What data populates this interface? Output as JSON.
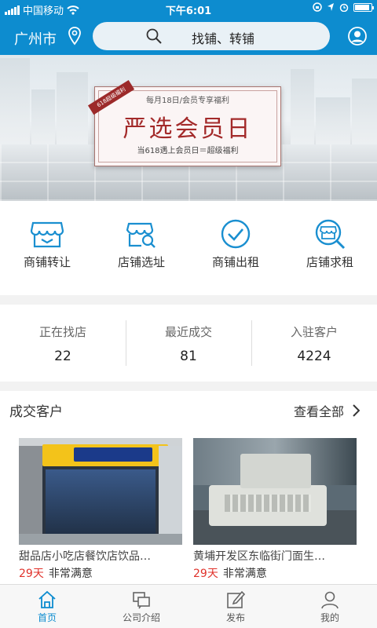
{
  "status_bar": {
    "carrier": "中国移动",
    "time": "下午6:01"
  },
  "header": {
    "city": "广州市",
    "search_placeholder": "找铺、转铺"
  },
  "banner": {
    "ribbon": "618超级福利",
    "subtitle": "每月18日/会员专享福利",
    "title": "严选会员日",
    "note": "当618遇上会员日＝超级福利"
  },
  "menu": [
    {
      "label": "商铺转让",
      "icon": "shop-transfer-icon"
    },
    {
      "label": "店铺选址",
      "icon": "shop-location-icon"
    },
    {
      "label": "商铺出租",
      "icon": "check-circle-icon"
    },
    {
      "label": "店铺求租",
      "icon": "shop-search-icon"
    }
  ],
  "stats": [
    {
      "label": "正在找店",
      "value": "22"
    },
    {
      "label": "最近成交",
      "value": "81"
    },
    {
      "label": "入驻客户",
      "value": "4224"
    }
  ],
  "deals": {
    "title": "成交客户",
    "view_all": "查看全部",
    "items": [
      {
        "name": "甜品店小吃店餐饮店饮品店转让",
        "name_display": "甜品店小吃店餐饮店饮品…",
        "days": "29天",
        "rating": "非常满意"
      },
      {
        "name": "黄埔开发区东临街门面生意转让",
        "name_display": "黄埔开发区东临街门面生…",
        "days": "29天",
        "rating": "非常满意"
      }
    ]
  },
  "tabbar": [
    {
      "label": "首页",
      "icon": "home-icon",
      "active": true
    },
    {
      "label": "公司介绍",
      "icon": "company-icon",
      "active": false
    },
    {
      "label": "发布",
      "icon": "edit-icon",
      "active": false
    },
    {
      "label": "我的",
      "icon": "profile-icon",
      "active": false
    }
  ],
  "colors": {
    "primary": "#0d8ccf",
    "accent_red": "#e0322b",
    "banner_red": "#a32a2a"
  }
}
